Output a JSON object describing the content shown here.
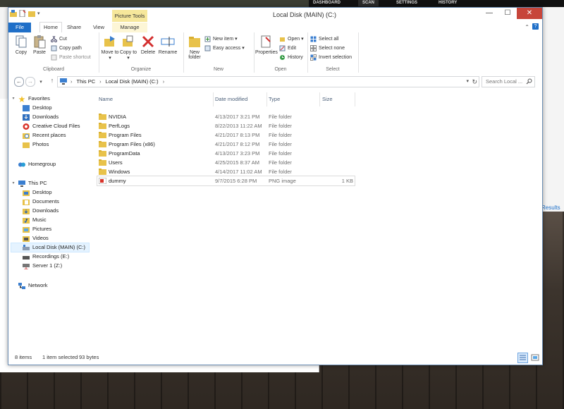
{
  "background": {
    "nav_items": [
      "DASHBOARD",
      "SCAN",
      "SETTINGS",
      "HISTORY"
    ],
    "results_link": "Results"
  },
  "window": {
    "title": "Local Disk (MAIN) (C:)",
    "context_tab_group": "Picture Tools",
    "controls": {
      "minimize": "—",
      "maximize": "☐",
      "close": "✕"
    }
  },
  "ribbon_tabs": {
    "file": "File",
    "home": "Home",
    "share": "Share",
    "view": "View",
    "manage": "Manage"
  },
  "ribbon": {
    "clipboard": {
      "label": "Clipboard",
      "copy": "Copy",
      "paste": "Paste",
      "cut": "Cut",
      "copy_path": "Copy path",
      "paste_shortcut": "Paste shortcut"
    },
    "organize": {
      "label": "Organize",
      "move_to": "Move to ▾",
      "copy_to": "Copy to ▾",
      "delete": "Delete",
      "rename": "Rename"
    },
    "new": {
      "label": "New",
      "new_folder": "New folder",
      "new_item": "New item ▾",
      "easy_access": "Easy access ▾"
    },
    "open": {
      "label": "Open",
      "properties": "Properties",
      "open": "Open ▾",
      "edit": "Edit",
      "history": "History"
    },
    "select": {
      "label": "Select",
      "select_all": "Select all",
      "select_none": "Select none",
      "invert_selection": "Invert selection"
    }
  },
  "address": {
    "crumbs": [
      "This PC",
      "Local Disk (MAIN) (C:)"
    ],
    "search_placeholder": "Search Local ..."
  },
  "nav": {
    "favorites": "Favorites",
    "favorites_items": [
      "Desktop",
      "Downloads",
      "Creative Cloud Files",
      "Recent places",
      "Photos"
    ],
    "homegroup": "Homegroup",
    "this_pc": "This PC",
    "this_pc_items": [
      "Desktop",
      "Documents",
      "Downloads",
      "Music",
      "Pictures",
      "Videos",
      "Local Disk (MAIN) (C:)",
      "Recordings (E:)",
      "Server 1 (Z:)"
    ],
    "network": "Network"
  },
  "columns": {
    "name": "Name",
    "date": "Date modified",
    "type": "Type",
    "size": "Size"
  },
  "files": [
    {
      "name": "NVIDIA",
      "date": "4/13/2017 3:21 PM",
      "type": "File folder",
      "size": ""
    },
    {
      "name": "PerfLogs",
      "date": "8/22/2013 11:22 AM",
      "type": "File folder",
      "size": ""
    },
    {
      "name": "Program Files",
      "date": "4/21/2017 8:13 PM",
      "type": "File folder",
      "size": ""
    },
    {
      "name": "Program Files (x86)",
      "date": "4/21/2017 8:12 PM",
      "type": "File folder",
      "size": ""
    },
    {
      "name": "ProgramData",
      "date": "4/13/2017 3:23 PM",
      "type": "File folder",
      "size": ""
    },
    {
      "name": "Users",
      "date": "4/25/2015 8:37 AM",
      "type": "File folder",
      "size": ""
    },
    {
      "name": "Windows",
      "date": "4/14/2017 11:02 AM",
      "type": "File folder",
      "size": ""
    },
    {
      "name": "dummy",
      "date": "9/7/2015 6:28 PM",
      "type": "PNG image",
      "size": "1 KB"
    }
  ],
  "status": {
    "count": "8 items",
    "selected": "1 item selected",
    "size": "93 bytes"
  }
}
